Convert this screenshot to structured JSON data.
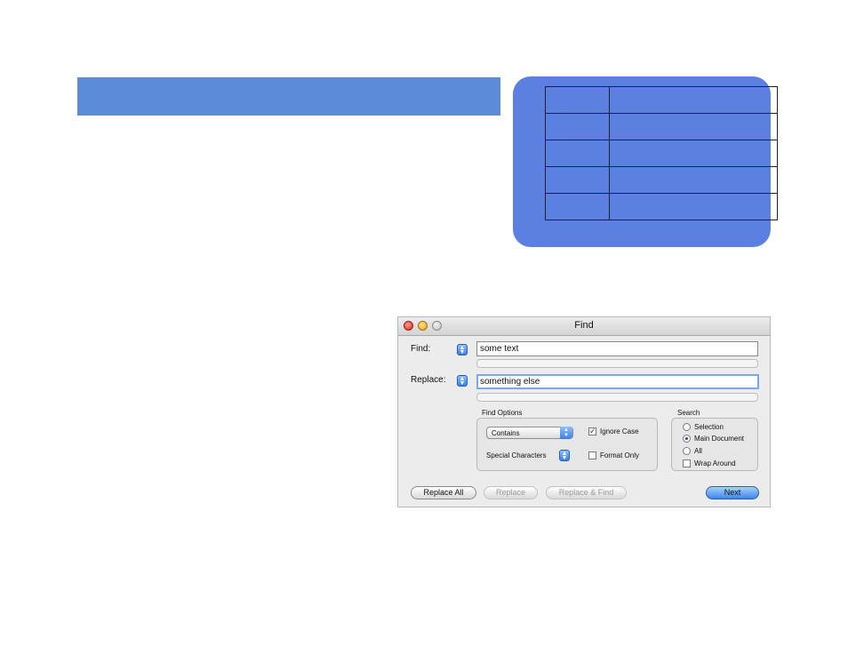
{
  "window": {
    "title": "Find"
  },
  "find": {
    "label": "Find:",
    "value": "some text"
  },
  "replace": {
    "label": "Replace:",
    "value": "something else"
  },
  "find_options": {
    "label": "Find Options",
    "match_mode": "Contains",
    "special_chars_label": "Special Characters",
    "ignore_case": {
      "label": "Ignore Case",
      "checked": true
    },
    "format_only": {
      "label": "Format Only",
      "checked": false
    }
  },
  "search": {
    "label": "Search",
    "options": [
      {
        "label": "Selection",
        "selected": false
      },
      {
        "label": "Main Document",
        "selected": true
      },
      {
        "label": "All",
        "selected": false
      }
    ],
    "wrap_around": {
      "label": "Wrap Around",
      "checked": false
    }
  },
  "buttons": {
    "replace_all": "Replace All",
    "replace": "Replace",
    "replace_find": "Replace & Find",
    "next": "Next"
  },
  "colors": {
    "slide_title_bar": "#5b8bd9",
    "table_panel": "#5b80e0"
  }
}
